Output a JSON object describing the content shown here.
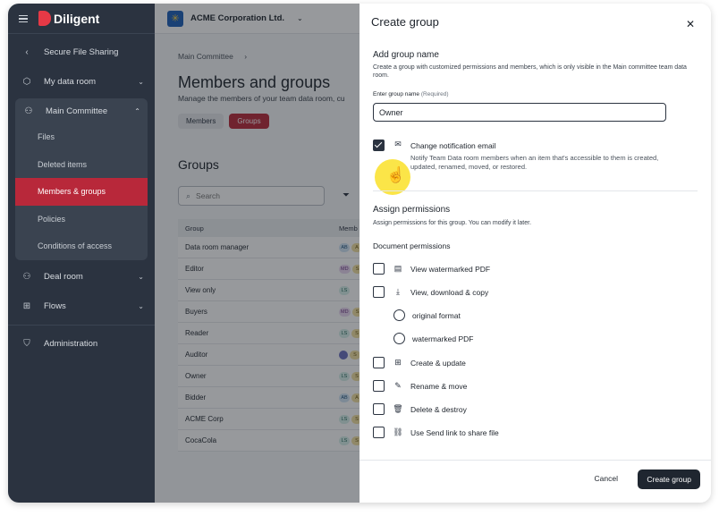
{
  "sidebar": {
    "brand": "Diligent",
    "back_item": "Secure File Sharing",
    "my_data_room": "My data room",
    "main_committee": {
      "label": "Main Committee",
      "items": [
        "Files",
        "Deleted items",
        "Members & groups",
        "Policies",
        "Conditions of access"
      ]
    },
    "deal_room": "Deal room",
    "flows": "Flows",
    "administration": "Administration"
  },
  "topbar": {
    "org_name": "ACME Corporation Ltd."
  },
  "main": {
    "breadcrumb": "Main Committee",
    "title": "Members and groups",
    "subtitle": "Manage the members of your team data room, cu",
    "tabs": [
      "Members",
      "Groups"
    ],
    "section_title": "Groups",
    "search_placeholder": "Search",
    "table": {
      "headers": [
        "Group",
        "Memb"
      ],
      "rows": [
        {
          "name": "Data room manager",
          "badges": [
            "AB",
            "A"
          ]
        },
        {
          "name": "Editor",
          "badges": [
            "MD",
            "S"
          ]
        },
        {
          "name": "View only",
          "badges": [
            "LS"
          ]
        },
        {
          "name": "Buyers",
          "badges": [
            "MD",
            "S"
          ]
        },
        {
          "name": "Reader",
          "badges": [
            "LS",
            "S"
          ]
        },
        {
          "name": "Auditor",
          "badges": [
            "",
            "S"
          ]
        },
        {
          "name": "Owner",
          "badges": [
            "LS",
            "S"
          ]
        },
        {
          "name": "Bidder",
          "badges": [
            "AB",
            "A"
          ]
        },
        {
          "name": "ACME Corp",
          "badges": [
            "LS",
            "S"
          ]
        },
        {
          "name": "CocaCola",
          "badges": [
            "LS",
            "S"
          ]
        }
      ]
    }
  },
  "drawer": {
    "title": "Create group",
    "add_name_heading": "Add group name",
    "add_name_desc": "Create a group with customized permissions and members, which is only visible in the Main committee team data room.",
    "name_label": "Enter group name",
    "name_required": "(Required)",
    "name_value": "Owner",
    "notify_label": "Change notification email",
    "notify_desc": "Notify Team Data room members when an item that's accessible to them is created, updated, renamed, moved, or restored.",
    "assign_heading": "Assign permissions",
    "assign_desc": "Assign permissions for this group. You can modify it later.",
    "doc_perm_heading": "Document permissions",
    "permissions": [
      "View watermarked PDF",
      "View, download & copy",
      "original format",
      "watermarked PDF",
      "Create & update",
      "Rename & move",
      "Delete & destroy",
      "Use Send link to share file"
    ],
    "cancel": "Cancel",
    "create": "Create group"
  }
}
